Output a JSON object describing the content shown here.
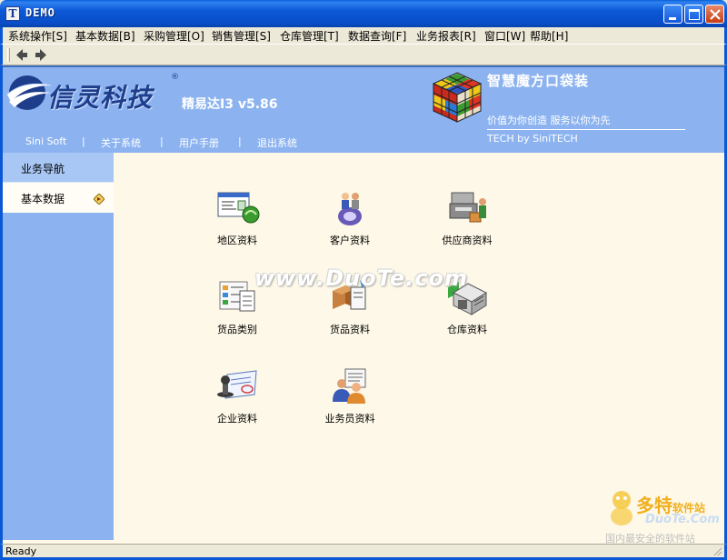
{
  "window": {
    "app_icon": "T",
    "title": "DEMO"
  },
  "menu": [
    {
      "label": "系统操作[S]"
    },
    {
      "label": "基本数据[B]"
    },
    {
      "label": "采购管理[O]"
    },
    {
      "label": "销售管理[S]"
    },
    {
      "label": "仓库管理[T]"
    },
    {
      "label": "数据查询[F]"
    },
    {
      "label": "业务报表[R]"
    },
    {
      "label": "窗口[W]"
    },
    {
      "label": "帮助[H]"
    }
  ],
  "toolbar": {
    "back_icon": "left-arrow-icon",
    "forward_icon": "right-arrow-icon"
  },
  "header": {
    "logo_text": "信灵科技",
    "logo_reg": "®",
    "version": "精易达I3  v5.86",
    "slogan_title": "智慧魔方口袋装",
    "slogan_sub": "价值为你创造  服务以你为先",
    "tech_by": "TECH by SiniTECH",
    "nav": [
      "Sini Soft",
      "关于系统",
      "用户手册",
      "退出系统"
    ],
    "nav_sep": "|"
  },
  "sidebar": {
    "items": [
      {
        "label": "业务导航"
      },
      {
        "label": "基本数据"
      }
    ]
  },
  "tiles": [
    {
      "label": "地区资料",
      "icon": "region-data-icon"
    },
    {
      "label": "客户资料",
      "icon": "customer-data-icon"
    },
    {
      "label": "供应商资料",
      "icon": "supplier-data-icon"
    },
    {
      "label": "货品类别",
      "icon": "goods-category-icon"
    },
    {
      "label": "货品资料",
      "icon": "goods-data-icon"
    },
    {
      "label": "仓库资料",
      "icon": "warehouse-data-icon"
    },
    {
      "label": "企业资料",
      "icon": "company-data-icon"
    },
    {
      "label": "业务员资料",
      "icon": "salesperson-data-icon"
    }
  ],
  "watermark": {
    "center": "www.DuoTe.com",
    "corner_title": "多特",
    "corner_title_small": "软件站",
    "corner_url": "DuoTe.Com",
    "corner_sub": "国内最安全的软件站"
  },
  "status": {
    "text": "Ready"
  },
  "colors": {
    "xp_blue": "#0b58d6",
    "header_blue": "#8cb3f0",
    "content_bg": "#fdf8e7"
  }
}
